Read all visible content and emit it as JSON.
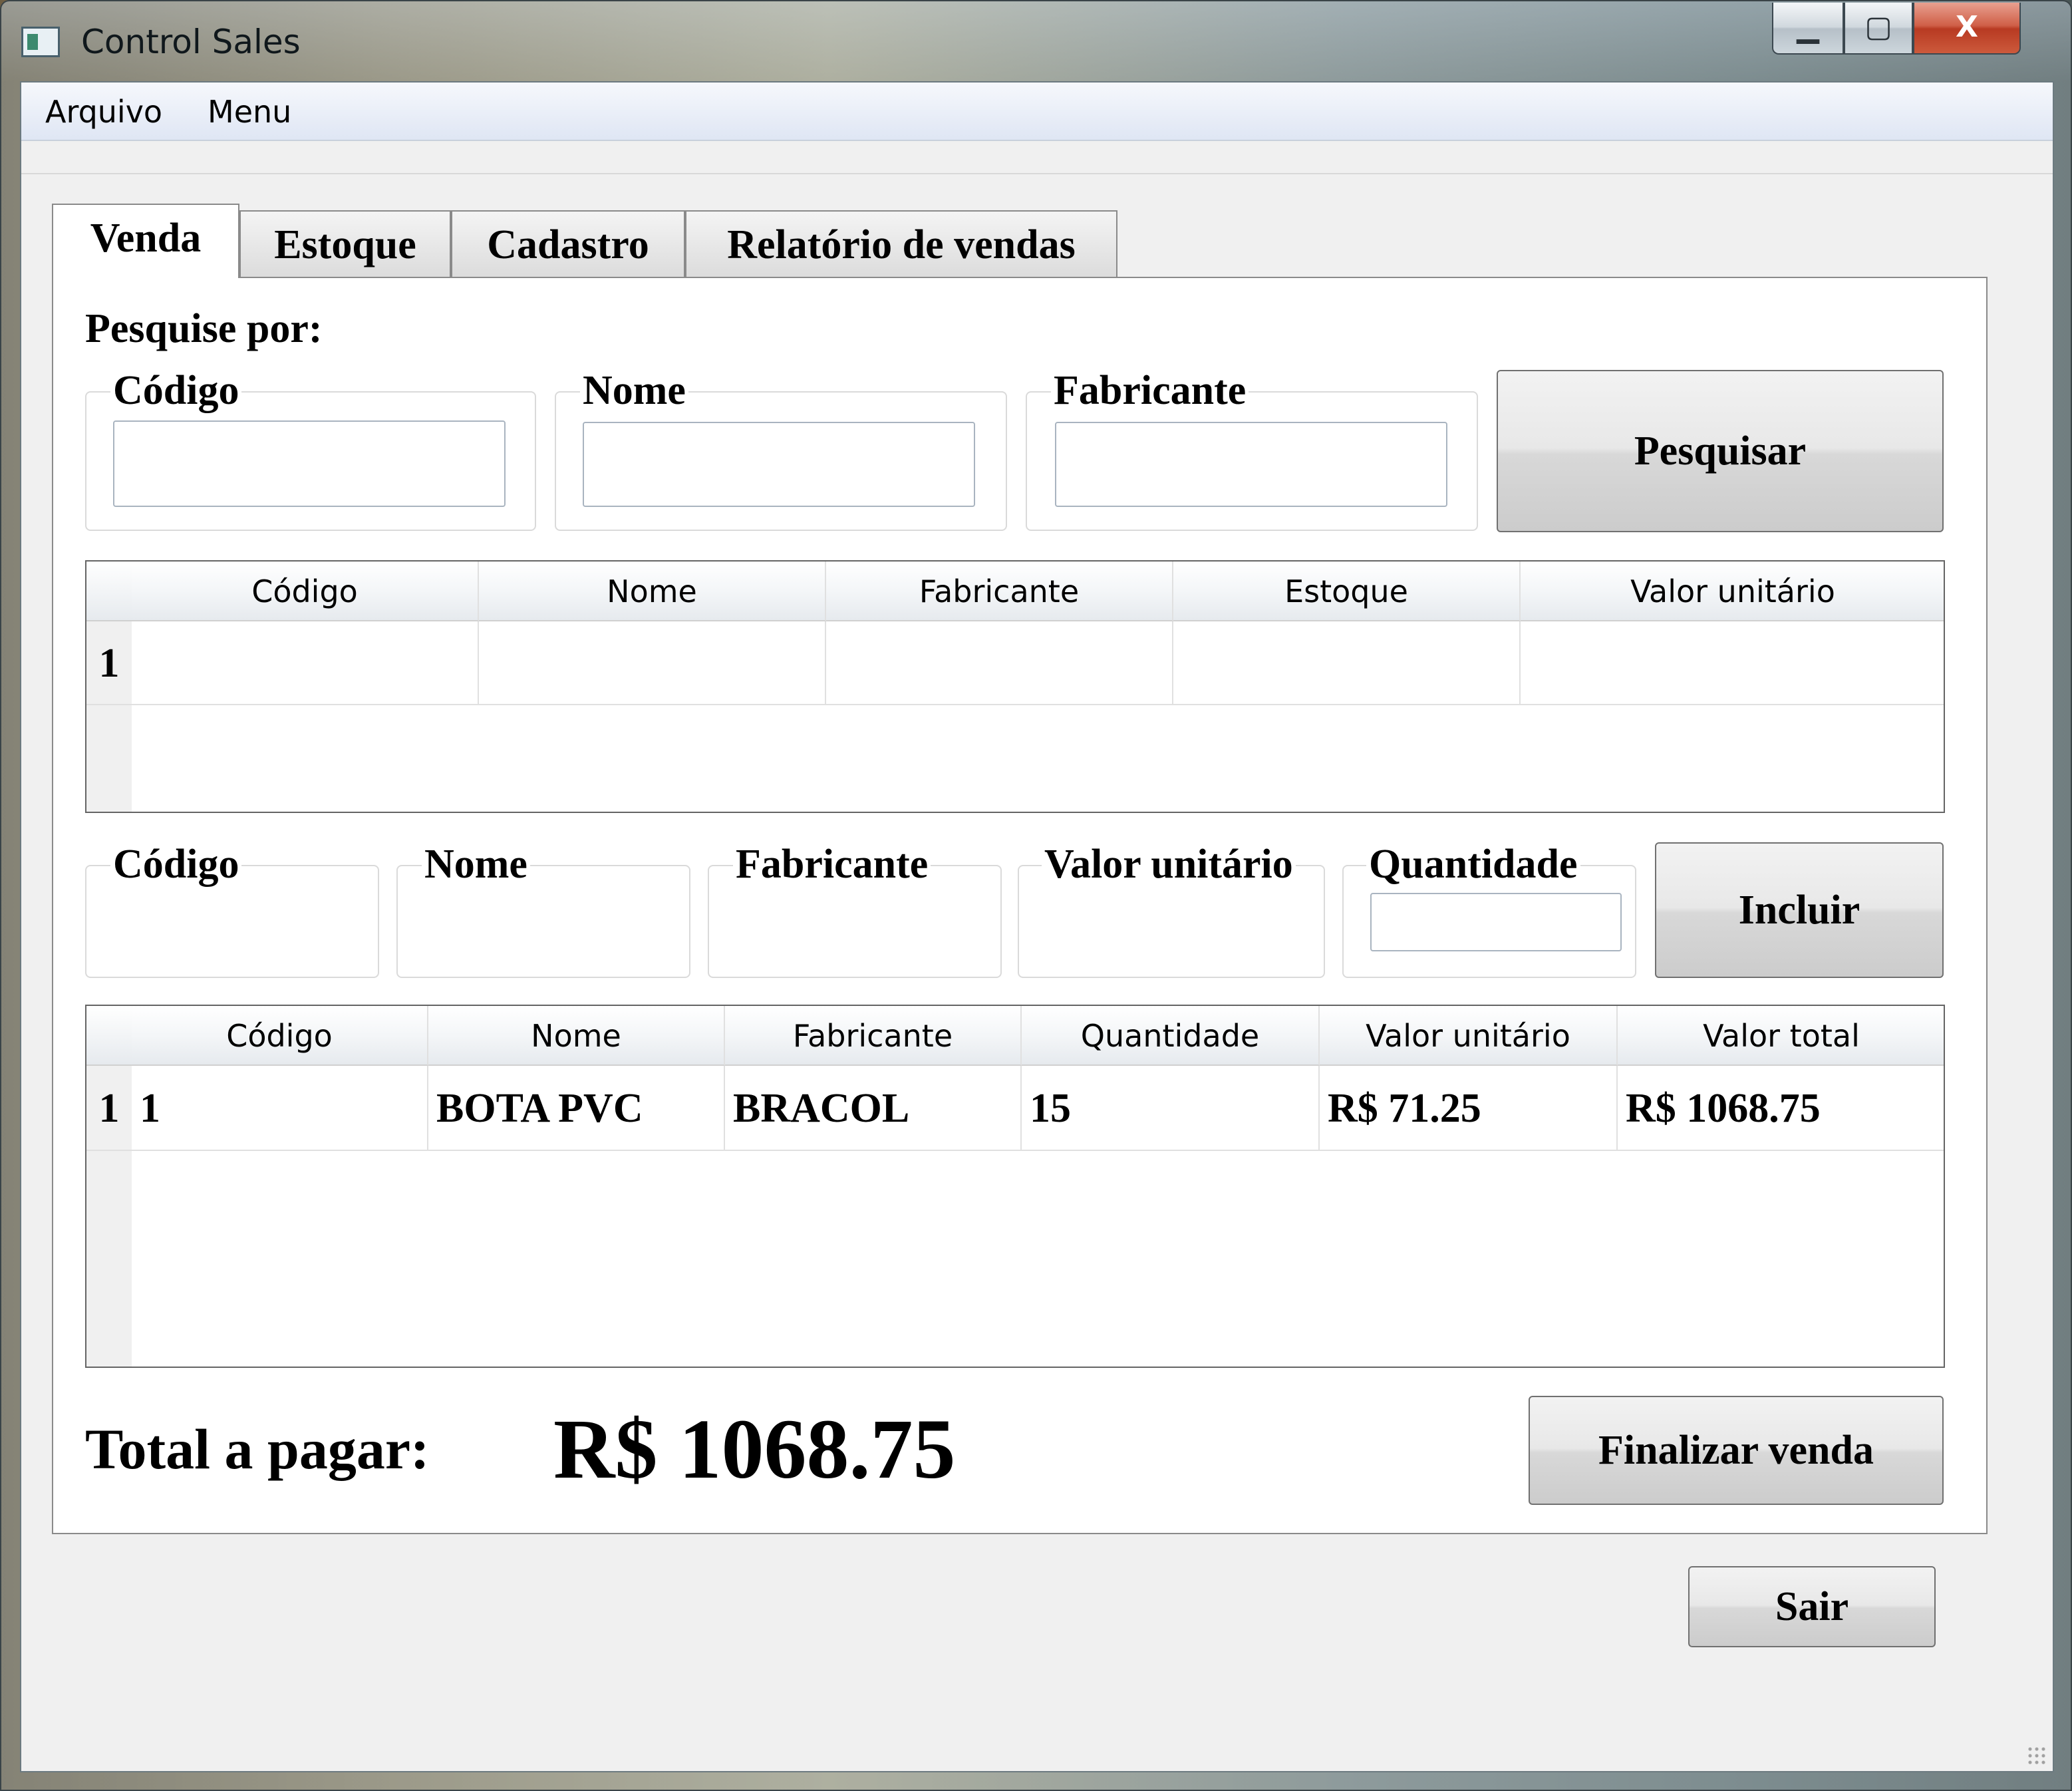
{
  "window": {
    "title": "Control Sales"
  },
  "menu": [
    "Arquivo",
    "Menu"
  ],
  "tabs": [
    "Venda",
    "Estoque",
    "Cadastro",
    "Relatório de vendas"
  ],
  "search": {
    "heading": "Pesquise por:",
    "fields": [
      {
        "label": "Código",
        "value": ""
      },
      {
        "label": "Nome",
        "value": ""
      },
      {
        "label": "Fabricante",
        "value": ""
      }
    ],
    "button": "Pesquisar"
  },
  "products_grid": {
    "columns": [
      "Código",
      "Nome",
      "Fabricante",
      "Estoque",
      "Valor unitário"
    ],
    "rows": [
      {
        "num": "1",
        "cells": [
          "",
          "",
          "",
          "",
          ""
        ]
      }
    ]
  },
  "item_form": {
    "fields": [
      "Código",
      "Nome",
      "Fabricante",
      "Valor unitário",
      "Quantidade"
    ],
    "quantity_value": "",
    "button": "Incluir"
  },
  "cart_grid": {
    "columns": [
      "Código",
      "Nome",
      "Fabricante",
      "Quantidade",
      "Valor unitário",
      "Valor total"
    ],
    "rows": [
      {
        "num": "1",
        "cells": [
          "1",
          "BOTA PVC",
          "BRACOL",
          "15",
          "R$ 71.25",
          "R$ 1068.75"
        ]
      }
    ]
  },
  "total": {
    "label": "Total a pagar:",
    "value": "R$ 1068.75"
  },
  "buttons": {
    "finalize": "Finalizar venda",
    "exit": "Sair"
  },
  "window_controls": {
    "minimize": "▁",
    "maximize": "▢",
    "close": "X"
  }
}
